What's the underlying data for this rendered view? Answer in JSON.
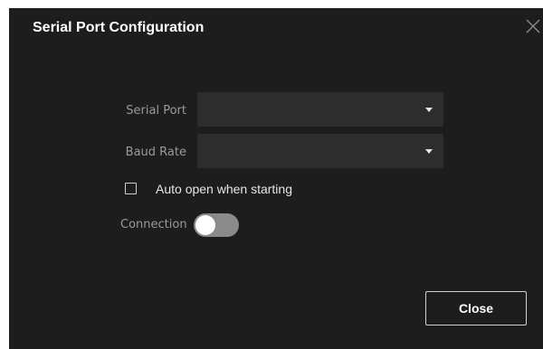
{
  "dialog": {
    "title": "Serial Port Configuration",
    "close_icon": "close-icon"
  },
  "form": {
    "serial_port": {
      "label": "Serial Port",
      "value": "",
      "icon": "chevron-down-icon"
    },
    "baud_rate": {
      "label": "Baud Rate",
      "value": "",
      "icon": "chevron-down-icon"
    },
    "auto_open": {
      "label": "Auto open when starting",
      "checked": false
    },
    "connection": {
      "label": "Connection",
      "enabled": false
    }
  },
  "footer": {
    "close_label": "Close"
  },
  "colors": {
    "background": "#1d1d1d",
    "field_bg": "#2d2d2d",
    "label": "#9a9a9a",
    "text": "#ffffff",
    "toggle_off": "#8a8a8a"
  }
}
